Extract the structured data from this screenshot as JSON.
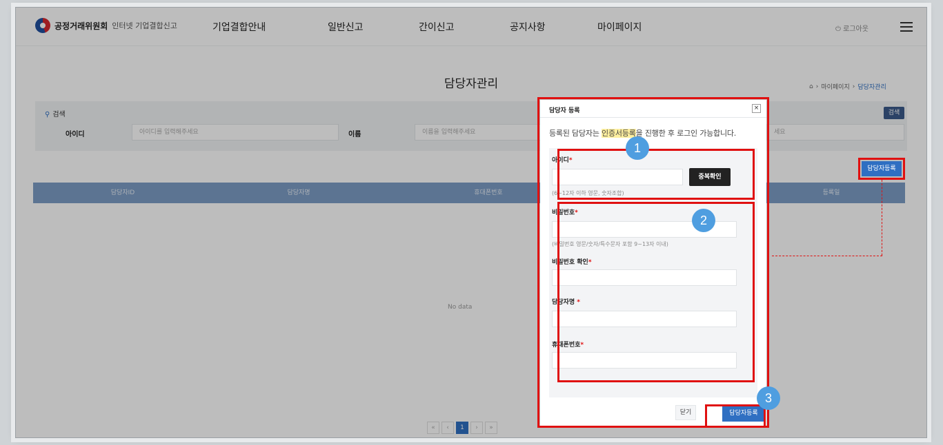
{
  "header": {
    "org_name": "공정거래위원회",
    "service_name": "인터넷 기업결합신고",
    "nav": [
      "기업결합안내",
      "일반신고",
      "간이신고",
      "공지사항",
      "마이페이지"
    ],
    "logout": "⏻ 로그아웃"
  },
  "page": {
    "title": "담당자관리",
    "breadcrumb": [
      "마이페이지",
      "담당자관리"
    ]
  },
  "search": {
    "title": "검색",
    "button": "검색",
    "id_label": "아이디",
    "id_placeholder": "아이디를 입력해주세요",
    "name_label": "이름",
    "name_placeholder": "이름을 입력해주세요",
    "third_placeholder": "세요"
  },
  "toolbar": {
    "register_button": "담당자등록"
  },
  "table": {
    "columns": [
      "담당자ID",
      "담당자명",
      "휴대폰번호",
      "",
      "등록일"
    ],
    "empty_text": "No data"
  },
  "pagination": {
    "current": "1",
    "first": "«",
    "prev": "‹",
    "next": "›",
    "last": "»"
  },
  "modal": {
    "title": "담당자 등록",
    "close_icon": "×",
    "notice_pre": "등록된 담당자는 ",
    "notice_highlight": "인증서등록",
    "notice_post": "을 진행한 후 로그인 가능합니다.",
    "id_label": "아이디",
    "dup_check_button": "중복확인",
    "id_hint": "(6~12자 이하 영문, 숫자조합)",
    "password_label": "비밀번호",
    "password_hint": "(비밀번호 영문/숫자/특수문자 포함 9~13자 이내)",
    "password_confirm_label": "비밀번호 확인",
    "manager_name_label": "담당자명 ",
    "phone_label": "휴대폰번호",
    "required_mark": "*",
    "close_button": "닫기",
    "submit_button": "담당자등록"
  },
  "annotations": {
    "badge_1": "1",
    "badge_2": "2",
    "badge_3": "3"
  }
}
